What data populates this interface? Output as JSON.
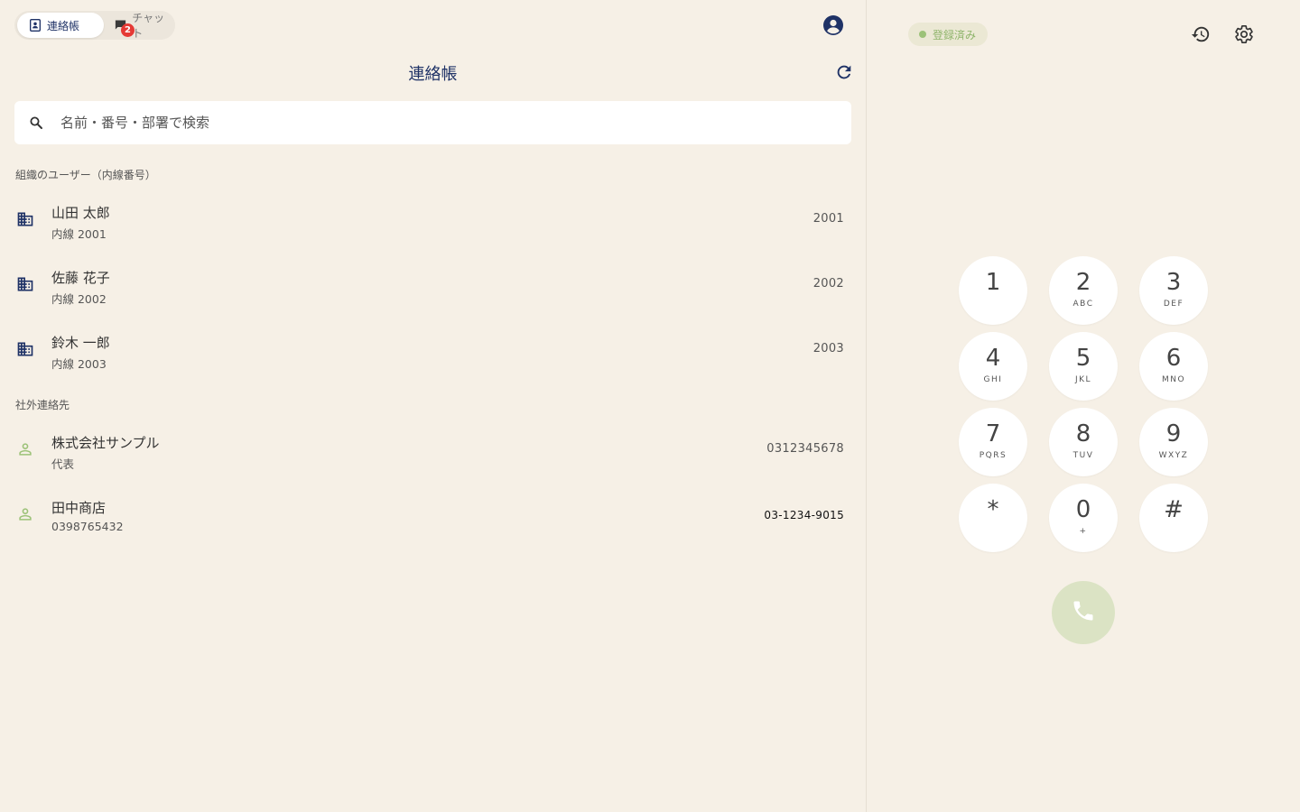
{
  "tabs": {
    "contacts_label": "連絡帳",
    "chat_label": "チャット",
    "chat_badge": "2"
  },
  "header": {
    "title": "連絡帳"
  },
  "search": {
    "placeholder": "名前・番号・部署で検索"
  },
  "sections": {
    "internal_label": "組織のユーザー（内線番号）",
    "external_label": "社外連絡先"
  },
  "internal_contacts": [
    {
      "name": "山田 太郎",
      "sub": "内線 2001",
      "number": "2001",
      "icon": "building-icon"
    },
    {
      "name": "佐藤 花子",
      "sub": "内線 2002",
      "number": "2002",
      "icon": "building-icon"
    },
    {
      "name": "鈴木 一郎",
      "sub": "内線 2003",
      "number": "2003",
      "icon": "building-icon"
    }
  ],
  "external_contacts": [
    {
      "name": "株式会社サンプル",
      "sub": "代表",
      "number": "0312345678",
      "icon": "person-icon"
    },
    {
      "name": "田中商店",
      "sub": "0398765432",
      "number": "03-1234-9015",
      "icon": "person-icon"
    }
  ],
  "status": {
    "label": "登録済み",
    "color": "#9cc278"
  },
  "dialpad": [
    {
      "digit": "1",
      "letters": ""
    },
    {
      "digit": "2",
      "letters": "ABC"
    },
    {
      "digit": "3",
      "letters": "DEF"
    },
    {
      "digit": "4",
      "letters": "GHI"
    },
    {
      "digit": "5",
      "letters": "JKL"
    },
    {
      "digit": "6",
      "letters": "MNO"
    },
    {
      "digit": "7",
      "letters": "PQRS"
    },
    {
      "digit": "8",
      "letters": "TUV"
    },
    {
      "digit": "9",
      "letters": "WXYZ"
    },
    {
      "digit": "*",
      "letters": ""
    },
    {
      "digit": "0",
      "letters": "+"
    },
    {
      "digit": "#",
      "letters": ""
    }
  ],
  "colors": {
    "accent": "#1f3266",
    "background": "#f6f0e6",
    "badge": "#e53935",
    "external_icon": "#9cc278",
    "call_button": "#dbe3c4"
  }
}
